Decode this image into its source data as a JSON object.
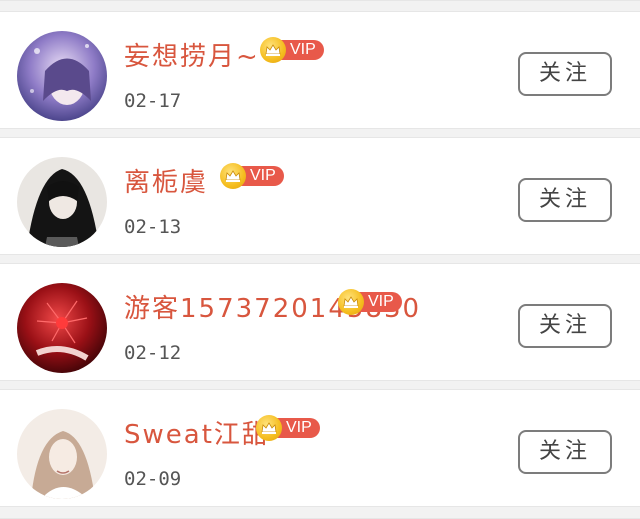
{
  "users": [
    {
      "name": "妄想捞月~",
      "vip_label": "VIP",
      "date": "02-17",
      "follow_label": "关注",
      "avatar_colors": [
        "#6b5fa8",
        "#c9b8e6",
        "#3f3a7a"
      ]
    },
    {
      "name": "离栀虞",
      "vip_label": "VIP",
      "date": "02-13",
      "follow_label": "关注",
      "avatar_colors": [
        "#1a1a1a",
        "#d9d4cf",
        "#4a4a4a"
      ]
    },
    {
      "name": "游客1573720145830",
      "vip_label": "VIP",
      "date": "02-12",
      "follow_label": "关注",
      "avatar_colors": [
        "#8e0f12",
        "#d2242a",
        "#3b0407"
      ]
    },
    {
      "name": "Sweat江甜",
      "vip_label": "VIP",
      "date": "02-09",
      "follow_label": "关注",
      "avatar_colors": [
        "#e9dcd2",
        "#b59784",
        "#f7f1ec"
      ]
    }
  ]
}
